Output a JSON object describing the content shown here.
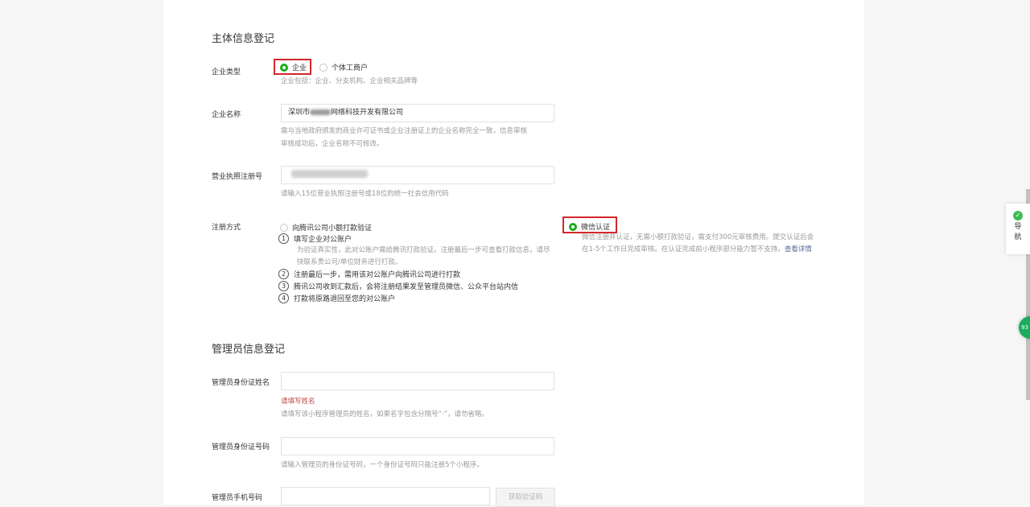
{
  "subject": {
    "title": "主体信息登记",
    "enterprise_type": {
      "label": "企业类型",
      "options": [
        "企业",
        "个体工商户"
      ],
      "selected": "企业",
      "hint": "企业包括：企业、分支机构、企业相关品牌等"
    },
    "enterprise_name": {
      "label": "企业名称",
      "value_prefix": "深圳市",
      "value_suffix": "网络科技开发有限公司",
      "hint_line1": "需与当地政府颁发的商业许可证书或企业注册证上的企业名称完全一致，信息审核",
      "hint_line2": "审核成功后，企业名称不可修改。"
    },
    "license": {
      "label": "营业执照注册号",
      "hint": "请输入15位营业执照注册号或18位的统一社会信用代码"
    },
    "register_method": {
      "label": "注册方式",
      "option1": "向腾讯公司小额打款验证",
      "option2": "微信认证",
      "selected": "微信认证",
      "steps": [
        {
          "num": "1",
          "text": "填写企业对公账户",
          "hint": "为验证真实性，此对公账户需给腾讯打款验证。注册最后一步可查看打款信息，请尽快联系贵公司/单位财务进行打款。"
        },
        {
          "num": "2",
          "text": "注册最后一步，需用该对公账户向腾讯公司进行打款"
        },
        {
          "num": "3",
          "text": "腾讯公司收到汇款后，会将注册结果发至管理员微信、公众平台站内信"
        },
        {
          "num": "4",
          "text": "打款将原路退回至您的对公账户"
        }
      ],
      "wechat_desc": "微信注册并认证，无需小额打款验证，需支付300元审核费用。提交认证后会在1-5个工作日完成审核。在认证完成前小程序部分能力暂不支持。",
      "wechat_link": "查看详情"
    }
  },
  "admin": {
    "title": "管理员信息登记",
    "name": {
      "label": "管理员身份证姓名",
      "error": "请填写姓名",
      "hint": "请填写该小程序管理员的姓名，如果名字包含分隔号“·”，请勿省略。"
    },
    "id_number": {
      "label": "管理员身份证号码",
      "hint": "请输入管理员的身份证号码，一个身份证号码只能注册5个小程序。"
    },
    "phone": {
      "label": "管理员手机号码",
      "get_code": "获取验证码"
    }
  },
  "nav": {
    "icon": "check-circle-icon",
    "label": "导航"
  },
  "float_badge": {
    "text": "93"
  },
  "colors": {
    "accent": "#1aad19",
    "highlight": "#d3262c",
    "error": "#c04848",
    "link": "#576b95"
  }
}
